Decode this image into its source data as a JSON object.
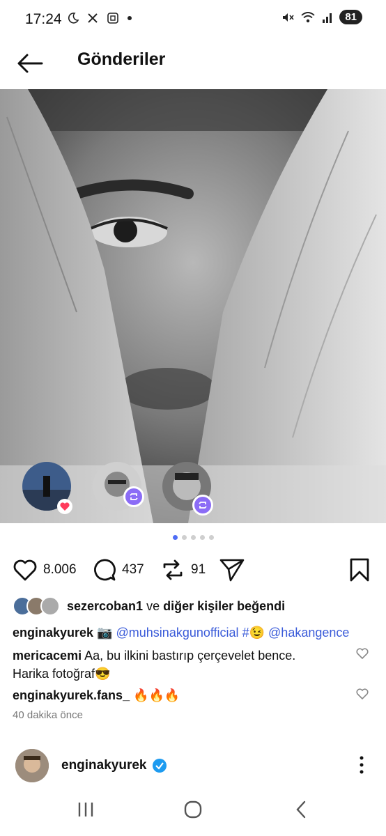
{
  "status_bar": {
    "time": "17:24",
    "battery": "81"
  },
  "header": {
    "title": "Gönderiler"
  },
  "post": {
    "image_alt": "black and white portrait",
    "carousel": {
      "count": 5,
      "active_index": 0
    },
    "reposter_bubbles": 3,
    "actions": {
      "likes": "8.006",
      "comments": "437",
      "reposts": "91"
    },
    "liked_by": {
      "user": "sezercoban1",
      "connector": " ve ",
      "rest": "diğer kişiler beğendi"
    },
    "caption": {
      "username": "enginakyurek",
      "text_camera": "📷",
      "mention1": "@muhsinakgunofficial",
      "hash": "#😉",
      "mention2": "@hakangence"
    },
    "comments": [
      {
        "username": "mericacemi",
        "text": "Aa, bu ilkini bastırıp çerçevelet bence.",
        "text2": "Harika fotoğraf😎"
      },
      {
        "username": "enginakyurek.fans_",
        "text": "🔥🔥🔥"
      }
    ],
    "time_ago": "40 dakika önce"
  },
  "next_post": {
    "username": "enginakyurek"
  },
  "colors": {
    "accent": "#4f6df5",
    "repost_badge": "#8b6cf6",
    "mention": "#3a5bd9",
    "verified": "#1d9bf0"
  }
}
